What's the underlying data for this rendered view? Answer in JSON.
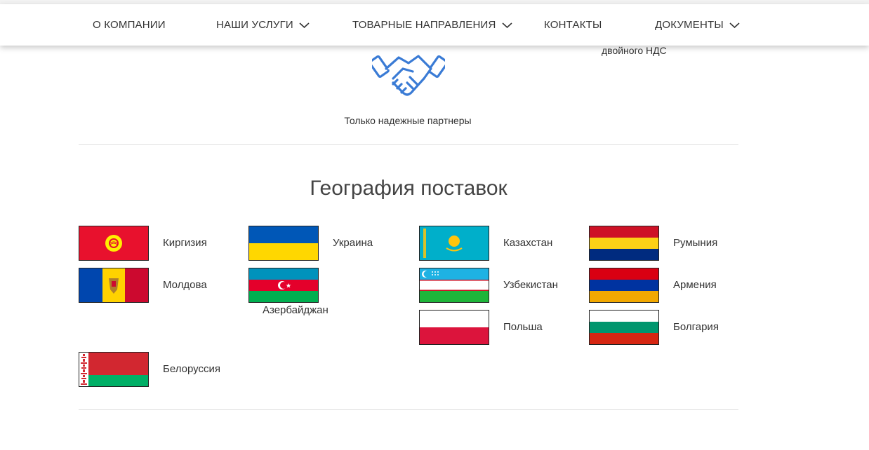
{
  "nav": {
    "items": [
      {
        "label": "О КОМПАНИИ",
        "dropdown": false
      },
      {
        "label": "НАШИ УСЛУГИ",
        "dropdown": true
      },
      {
        "label": "ТОВАРНЫЕ НАПРАВЛЕНИЯ",
        "dropdown": true
      },
      {
        "label": "КОНТАКТЫ",
        "dropdown": false
      },
      {
        "label": "ДОКУМЕНТЫ",
        "dropdown": true
      }
    ]
  },
  "features": {
    "partial_caption": "двойного НДС",
    "partners_caption": "Только надежные партнеры",
    "handshake_icon": "handshake-icon",
    "icon_color": "#3a7bd5"
  },
  "geography": {
    "title": "География поставок",
    "countries": [
      {
        "name": "Киргизия",
        "flag": "kyrgyzstan-flag"
      },
      {
        "name": "Украина",
        "flag": "ukraine-flag"
      },
      {
        "name": "Казахстан",
        "flag": "kazakhstan-flag"
      },
      {
        "name": "Румыния",
        "flag": "romania-flag"
      },
      {
        "name": "Молдова",
        "flag": "moldova-flag"
      },
      {
        "name": "Азербайджан",
        "flag": "azerbaijan-flag"
      },
      {
        "name": "Узбекистан",
        "flag": "uzbekistan-flag"
      },
      {
        "name": "Армения",
        "flag": "armenia-flag"
      },
      {
        "name": "Польша",
        "flag": "poland-flag"
      },
      {
        "name": "Болгария",
        "flag": "bulgaria-flag"
      },
      {
        "name": "Белоруссия",
        "flag": "belarus-flag"
      }
    ]
  }
}
